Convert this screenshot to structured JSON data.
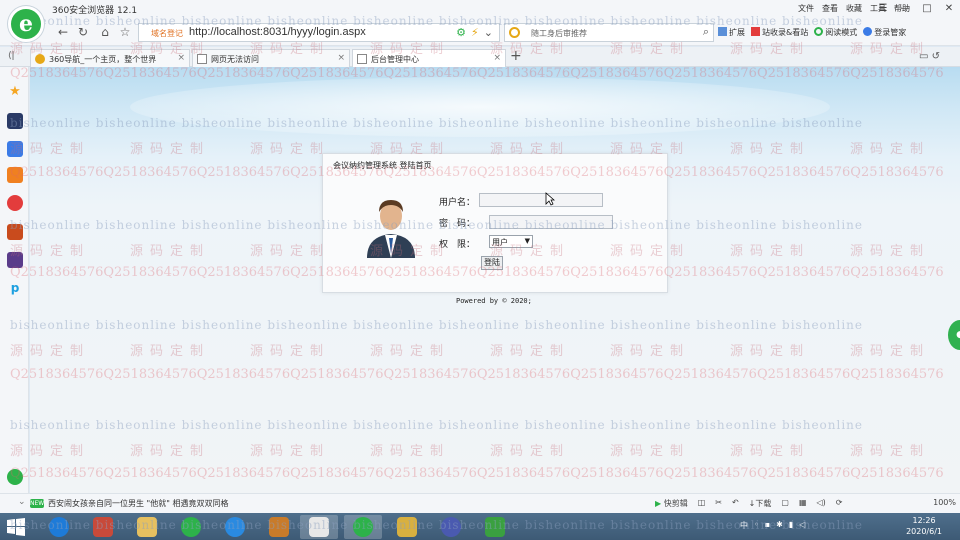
{
  "browser": {
    "window_title": "360安全浏览器 12.1",
    "top_menu": [
      "文件",
      "查看",
      "收藏",
      "工具",
      "帮助"
    ],
    "window_controls": [
      "☰",
      "—",
      "□",
      "✕"
    ]
  },
  "addressbar": {
    "security_text": "域名登记",
    "url": "http://localhost:8031/hyyy/login.aspx",
    "search_placeholder": "随工身后审推荐",
    "right_tools": [
      "扩展",
      "站收录&看站",
      "阅读模式",
      "登录管家"
    ]
  },
  "tabs": [
    {
      "label": "360导航_一个主页，整个世界",
      "active": false
    },
    {
      "label": "网页无法访问",
      "active": false
    },
    {
      "label": "后台管理中心",
      "active": true
    }
  ],
  "sidebar": {
    "items": [
      {
        "icon": "star-icon",
        "color": "#f5a623"
      },
      {
        "icon": "app-icon",
        "color": "#2a3a66"
      },
      {
        "icon": "doc-icon",
        "color": "#3b7be6"
      },
      {
        "icon": "game-icon",
        "color": "#f08020"
      },
      {
        "icon": "shop-icon",
        "color": "#e33c3c"
      },
      {
        "icon": "game2-icon",
        "color": "#c94b1d"
      },
      {
        "icon": "game3-icon",
        "color": "#5a3c8a"
      },
      {
        "icon": "p-icon",
        "color": "#1ea0e0"
      }
    ]
  },
  "watermark": {
    "text_a": "bisheonline",
    "text_b": "源码定制",
    "text_c": "Q2518364576"
  },
  "login": {
    "title": "会议纳约管理系统 登陆首页",
    "username_label": "用户名：",
    "password_label": "密　码：",
    "role_label": "权　限：",
    "role_value": "用户",
    "button_label": "登陆",
    "powered": "Powered by © 2020;"
  },
  "statusbar": {
    "news_badge": "NEW",
    "news_text": "西安闹女孩亲自同一位男生 \"他就\" 相遇竟双双同格",
    "items": [
      "快剪辑",
      "下载"
    ],
    "zoom": "100%"
  },
  "taskbar": {
    "tray_lang": "中",
    "time": "12:26",
    "date": "2020/6/1"
  },
  "colors": {
    "brand_green": "#2db24a",
    "page_sky": "#b8dcf1",
    "taskbar": "#3d5a75"
  }
}
